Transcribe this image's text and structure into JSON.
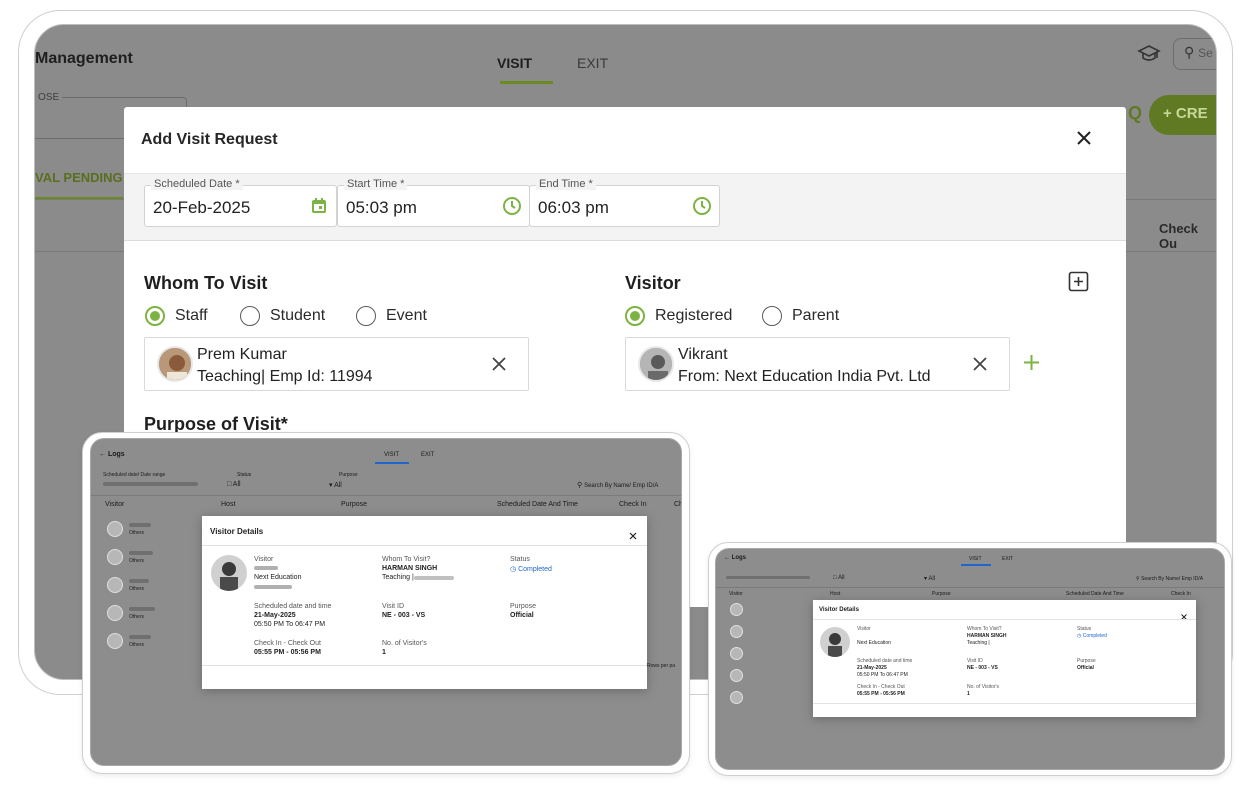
{
  "app": {
    "title": "Management",
    "tabs": [
      "VISIT",
      "EXIT"
    ],
    "field_label": "OSE",
    "pending_tab": "VAL PENDING",
    "check_out": "Check Ou",
    "create_button": "+ CRE",
    "search_placeholder": "Se"
  },
  "modal": {
    "title": "Add Visit Request",
    "scheduled_date": {
      "label": "Scheduled Date *",
      "value": "20-Feb-2025"
    },
    "start_time": {
      "label": "Start Time *",
      "value": "05:03 pm"
    },
    "end_time": {
      "label": "End Time *",
      "value": "06:03 pm"
    },
    "whom_to_visit": {
      "heading": "Whom To Visit",
      "options": [
        "Staff",
        "Student",
        "Event"
      ],
      "selected": "Staff",
      "person": {
        "name": "Prem Kumar",
        "detail": "Teaching| Emp Id: 11994"
      }
    },
    "visitor": {
      "heading": "Visitor",
      "options": [
        "Registered",
        "Parent"
      ],
      "selected": "Registered",
      "person": {
        "name": "Vikrant",
        "detail": "From: Next Education India Pvt. Ltd"
      }
    },
    "purpose_heading": "Purpose of Visit*"
  },
  "logs_screen": {
    "back_title": "Logs",
    "tabs": [
      "VISIT",
      "EXIT"
    ],
    "filter_label": "Scheduled date/ Date range",
    "status_label": "Status",
    "status_value": "All",
    "purpose_label": "Purpose",
    "purpose_value": "All",
    "search_placeholder": "Search By Name/ Emp ID/A",
    "columns": [
      "Visitor",
      "Host",
      "Purpose",
      "Scheduled Date And Time",
      "Check In",
      "Ch"
    ],
    "row_sub": "Others",
    "rows_per_page": "Rows per pa"
  },
  "visitor_details": {
    "title": "Visitor Details",
    "visitor_label": "Visitor",
    "visitor_company": "Next Education",
    "whom_label": "Whom To Visit?",
    "whom_name": "HARMAN SINGH",
    "whom_detail": "Teaching |",
    "status_label": "Status",
    "status_value": "Completed",
    "scheduled_label": "Scheduled date and time",
    "scheduled_date": "21-May-2025",
    "scheduled_time": "05:50 PM To 06:47 PM",
    "visit_id_label": "Visit ID",
    "visit_id": "NE - 003 - VS",
    "purpose_label": "Purpose",
    "purpose_value": "Official",
    "checkin_label": "Check In - Check Out",
    "checkin_value": "05:55 PM - 05:56 PM",
    "visitors_label": "No. of Visitor's",
    "visitors_value": "1"
  },
  "colors": {
    "accent": "#7cb342",
    "dark_accent": "#5f7a22",
    "status_blue": "#1f66cc",
    "overlay": "#8b8b8b"
  },
  "icons": [
    "calendar-icon",
    "clock-icon",
    "close-icon",
    "add-box-icon",
    "plus-icon",
    "graduation-cap-icon",
    "search-icon"
  ]
}
